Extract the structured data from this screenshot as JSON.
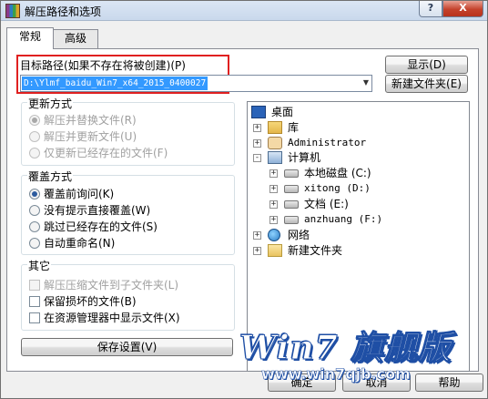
{
  "window": {
    "title": "解压路径和选项",
    "help_button": "?",
    "close_button": "X"
  },
  "tabs": [
    {
      "label": "常规",
      "active": true
    },
    {
      "label": "高级",
      "active": false
    }
  ],
  "target_path": {
    "label": "目标路径(如果不存在将被创建)(P)",
    "value": "D:\\Ylmf_baidu_Win7_x64_2015_0400027",
    "show_button": "显示(D)",
    "new_folder_button": "新建文件夹(E)"
  },
  "update_mode": {
    "title": "更新方式",
    "options": [
      {
        "label": "解压并替换文件(R)",
        "selected": true
      },
      {
        "label": "解压并更新文件(U)",
        "selected": false
      },
      {
        "label": "仅更新已经存在的文件(F)",
        "selected": false
      }
    ]
  },
  "overwrite_mode": {
    "title": "覆盖方式",
    "options": [
      {
        "label": "覆盖前询问(K)",
        "selected": true
      },
      {
        "label": "没有提示直接覆盖(W)",
        "selected": false
      },
      {
        "label": "跳过已经存在的文件(S)",
        "selected": false
      },
      {
        "label": "自动重命名(N)",
        "selected": false
      }
    ]
  },
  "other": {
    "title": "其它",
    "options": [
      {
        "label": "解压压缩文件到子文件夹(L)",
        "checked": false
      },
      {
        "label": "保留损坏的文件(B)",
        "checked": false
      },
      {
        "label": "在资源管理器中显示文件(X)",
        "checked": false
      }
    ]
  },
  "save_settings_button": "保存设置(V)",
  "tree": [
    {
      "label": "桌面",
      "icon": "desktop-icon",
      "expander": ""
    },
    {
      "label": "库",
      "icon": "library-icon",
      "expander": "+"
    },
    {
      "label": "Administrator",
      "icon": "user-folder-icon",
      "expander": "+"
    },
    {
      "label": "计算机",
      "icon": "computer-icon",
      "expander": "-"
    },
    {
      "label": "本地磁盘 (C:)",
      "icon": "system-drive-icon",
      "expander": "+"
    },
    {
      "label": "xitong (D:)",
      "icon": "drive-icon",
      "expander": "+"
    },
    {
      "label": "文档 (E:)",
      "icon": "drive-icon",
      "expander": "+"
    },
    {
      "label": "anzhuang (F:)",
      "icon": "drive-icon",
      "expander": "+"
    },
    {
      "label": "网络",
      "icon": "network-icon",
      "expander": "+"
    },
    {
      "label": "新建文件夹",
      "icon": "folder-icon",
      "expander": "+"
    }
  ],
  "watermark": {
    "main": "Win7 旗舰版",
    "url": "www.win7qjb.com"
  },
  "dialog_buttons": {
    "ok": "确定",
    "cancel": "取消",
    "help": "帮助"
  }
}
